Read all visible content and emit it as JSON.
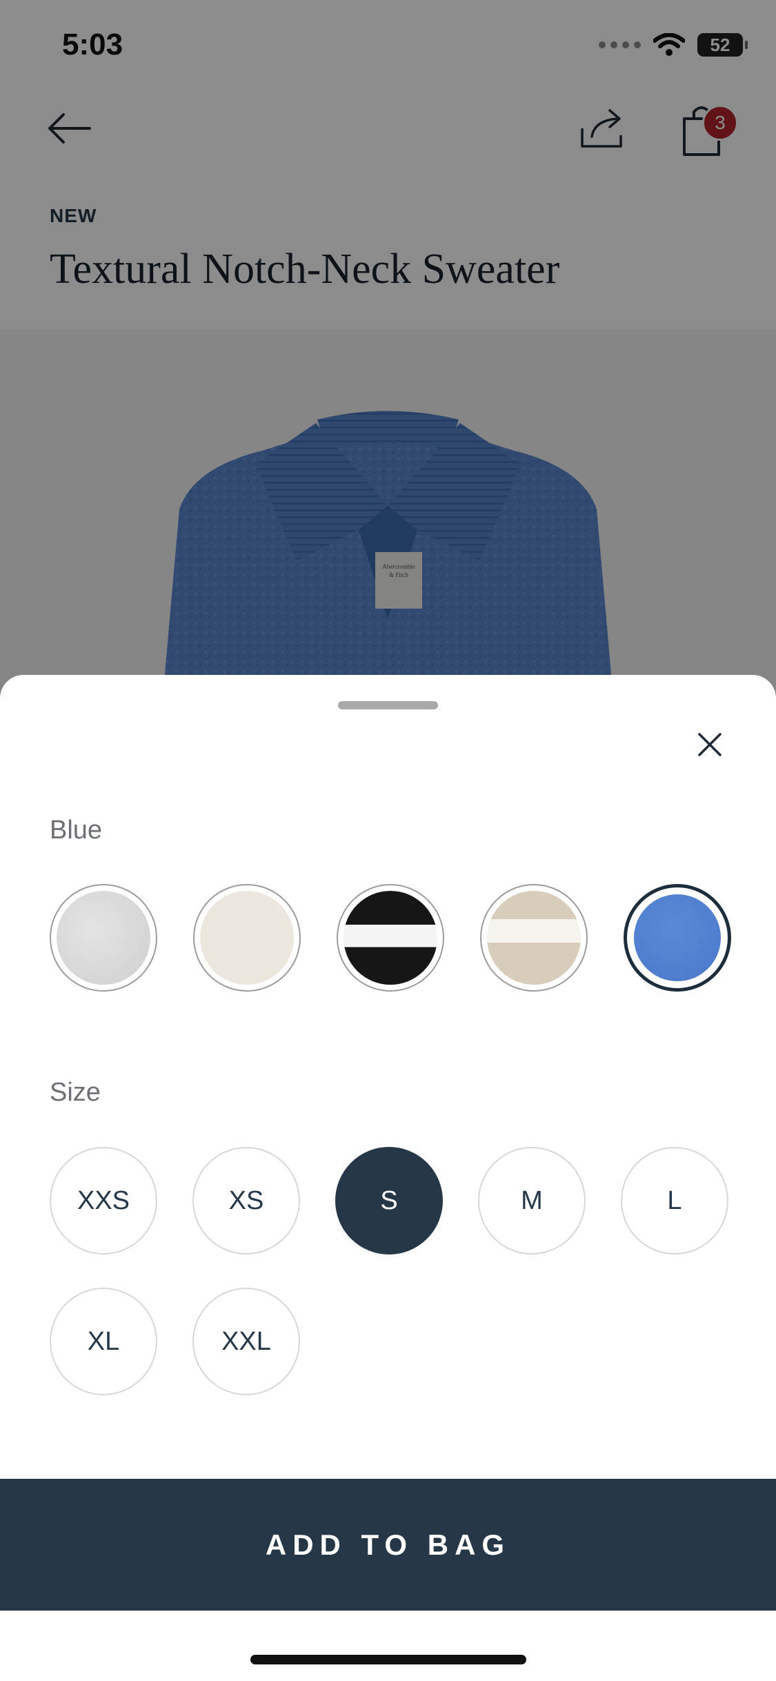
{
  "status_bar": {
    "time": "5:03",
    "battery": "52"
  },
  "header": {
    "bag_count": "3"
  },
  "product": {
    "tag": "NEW",
    "title": "Textural Notch-Neck Sweater",
    "label_text": "Abercrombie & Fitch"
  },
  "sheet": {
    "color_label": "Blue",
    "colors": [
      {
        "name": "Light heather grey",
        "hex": "#d6d6d6"
      },
      {
        "name": "Cream",
        "hex": "#ece7dd"
      },
      {
        "name": "Black stripe",
        "hex": "#161616"
      },
      {
        "name": "Cream stripe",
        "hex": "#ddd3c3"
      },
      {
        "name": "Blue",
        "hex": "#4f7dd0",
        "selected": true
      }
    ],
    "size_label": "Size",
    "sizes": [
      "XXS",
      "XS",
      "S",
      "M",
      "L",
      "XL",
      "XXL"
    ],
    "selected_size": "S",
    "add_button": "ADD TO BAG"
  }
}
